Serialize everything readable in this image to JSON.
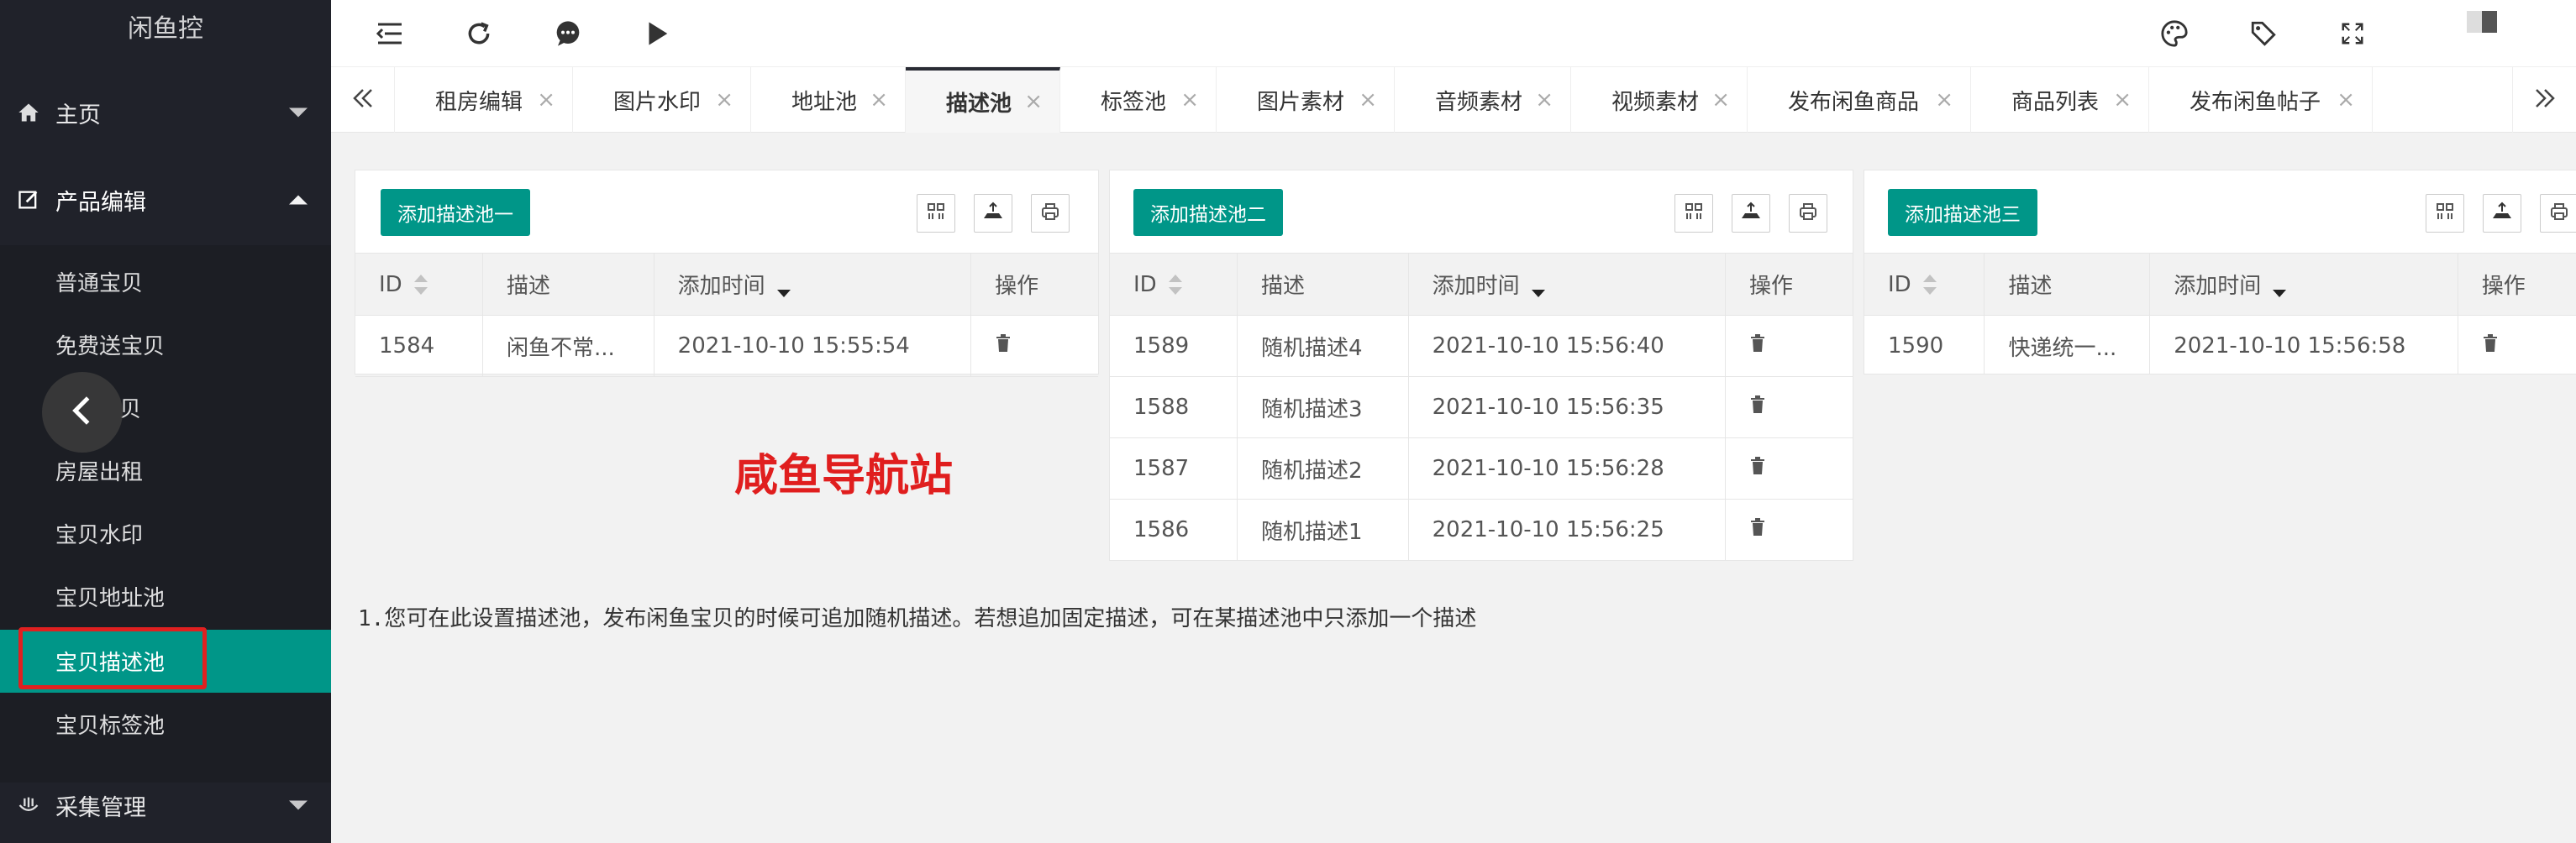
{
  "app": {
    "title": "闲鱼控"
  },
  "sidebar": {
    "top_items": [
      {
        "label": "主页",
        "icon": "home-icon"
      },
      {
        "label": "产品编辑",
        "icon": "edit-icon"
      },
      {
        "label": "采集管理",
        "icon": "collect-icon"
      }
    ],
    "sub_items": [
      {
        "label": "普通宝贝"
      },
      {
        "label": "免费送宝贝"
      },
      {
        "label": "贝"
      },
      {
        "label": "房屋出租"
      },
      {
        "label": "宝贝水印"
      },
      {
        "label": "宝贝地址池"
      },
      {
        "label": "宝贝描述池"
      },
      {
        "label": "宝贝标签池"
      }
    ],
    "active_item": "宝贝描述池"
  },
  "header": {
    "icons": [
      "menu-collapse-icon",
      "refresh-icon",
      "chat-icon",
      "play-icon",
      "theme-icon",
      "tag-icon",
      "fullscreen-icon",
      "user-avatar"
    ]
  },
  "tabs": [
    {
      "label": "租房编辑"
    },
    {
      "label": "图片水印"
    },
    {
      "label": "地址池"
    },
    {
      "label": "描述池",
      "active": true
    },
    {
      "label": "标签池"
    },
    {
      "label": "图片素材"
    },
    {
      "label": "音频素材"
    },
    {
      "label": "视频素材"
    },
    {
      "label": "发布闲鱼商品"
    },
    {
      "label": "商品列表"
    },
    {
      "label": "发布闲鱼帖子"
    }
  ],
  "tab_close_glyph": "×",
  "panels": [
    {
      "add_button": "添加描述池一",
      "columns": [
        "ID",
        "描述",
        "添加时间",
        "操作"
      ],
      "rows": [
        {
          "id": "1584",
          "desc": "闲鱼不常...",
          "time": "2021-10-10 15:55:54"
        }
      ]
    },
    {
      "add_button": "添加描述池二",
      "columns": [
        "ID",
        "描述",
        "添加时间",
        "操作"
      ],
      "rows": [
        {
          "id": "1589",
          "desc": "随机描述4",
          "time": "2021-10-10 15:56:40"
        },
        {
          "id": "1588",
          "desc": "随机描述3",
          "time": "2021-10-10 15:56:35"
        },
        {
          "id": "1587",
          "desc": "随机描述2",
          "time": "2021-10-10 15:56:28"
        },
        {
          "id": "1586",
          "desc": "随机描述1",
          "time": "2021-10-10 15:56:25"
        }
      ]
    },
    {
      "add_button": "添加描述池三",
      "columns": [
        "ID",
        "描述",
        "添加时间",
        "操作"
      ],
      "rows": [
        {
          "id": "1590",
          "desc": "快递统一...",
          "time": "2021-10-10 15:56:58"
        }
      ]
    }
  ],
  "watermark": "咸鱼导航站",
  "note": {
    "prefix": "1.",
    "text": "您可在此设置描述池，发布闲鱼宝贝的时候可追加随机描述。若想追加固定描述，可在某描述池中只添加一个描述"
  },
  "colors": {
    "accent": "#009688",
    "sidebar_bg": "#20222a",
    "highlight": "#e02020",
    "watermark": "#e01e1e"
  }
}
